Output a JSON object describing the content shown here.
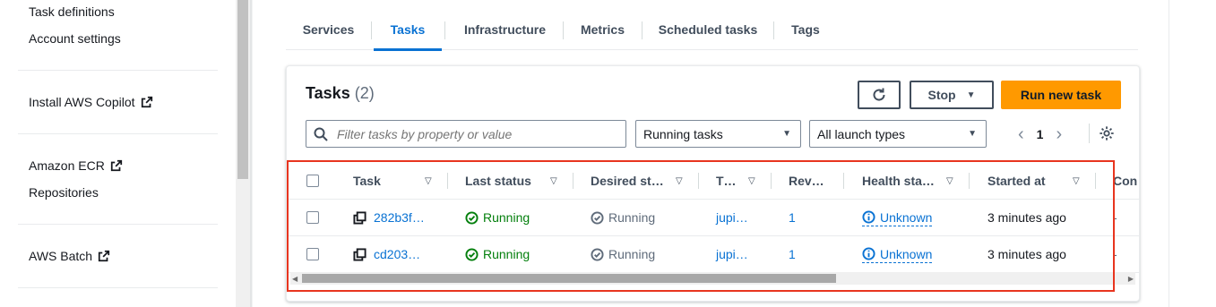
{
  "sidebar": {
    "links": [
      {
        "label": "Task definitions",
        "external": false
      },
      {
        "label": "Account settings",
        "external": false
      },
      {
        "label": "Install AWS Copilot",
        "external": true
      },
      {
        "label": "Amazon ECR",
        "external": true
      },
      {
        "label": "Repositories",
        "external": false
      },
      {
        "label": "AWS Batch",
        "external": true
      }
    ]
  },
  "tabs": [
    {
      "label": "Services",
      "active": false
    },
    {
      "label": "Tasks",
      "active": true
    },
    {
      "label": "Infrastructure",
      "active": false
    },
    {
      "label": "Metrics",
      "active": false
    },
    {
      "label": "Scheduled tasks",
      "active": false
    },
    {
      "label": "Tags",
      "active": false
    }
  ],
  "tasks_panel": {
    "title": "Tasks",
    "count": "(2)",
    "refresh_icon": "refresh-icon",
    "stop_label": "Stop",
    "run_label": "Run new task",
    "filter_placeholder": "Filter tasks by property or value",
    "status_filter": "Running tasks",
    "launch_filter": "All launch types",
    "page": "1"
  },
  "table": {
    "headers": [
      "Task",
      "Last status",
      "Desired st…",
      "T…",
      "Rev…",
      "Health sta…",
      "Started at",
      "Con"
    ],
    "rows": [
      {
        "task": "282b3f…",
        "last_status": "Running",
        "desired_status": "Running",
        "task_def": "jupi…",
        "revision": "1",
        "health": "Unknown",
        "started": "3 minutes ago",
        "container": "-"
      },
      {
        "task": "cd203…",
        "last_status": "Running",
        "desired_status": "Running",
        "task_def": "jupi…",
        "revision": "1",
        "health": "Unknown",
        "started": "3 minutes ago",
        "container": "-"
      }
    ]
  },
  "colors": {
    "accent": "#0972d3",
    "primary_button": "#ff9900",
    "success": "#037f0c",
    "highlight": "#e8351f"
  }
}
